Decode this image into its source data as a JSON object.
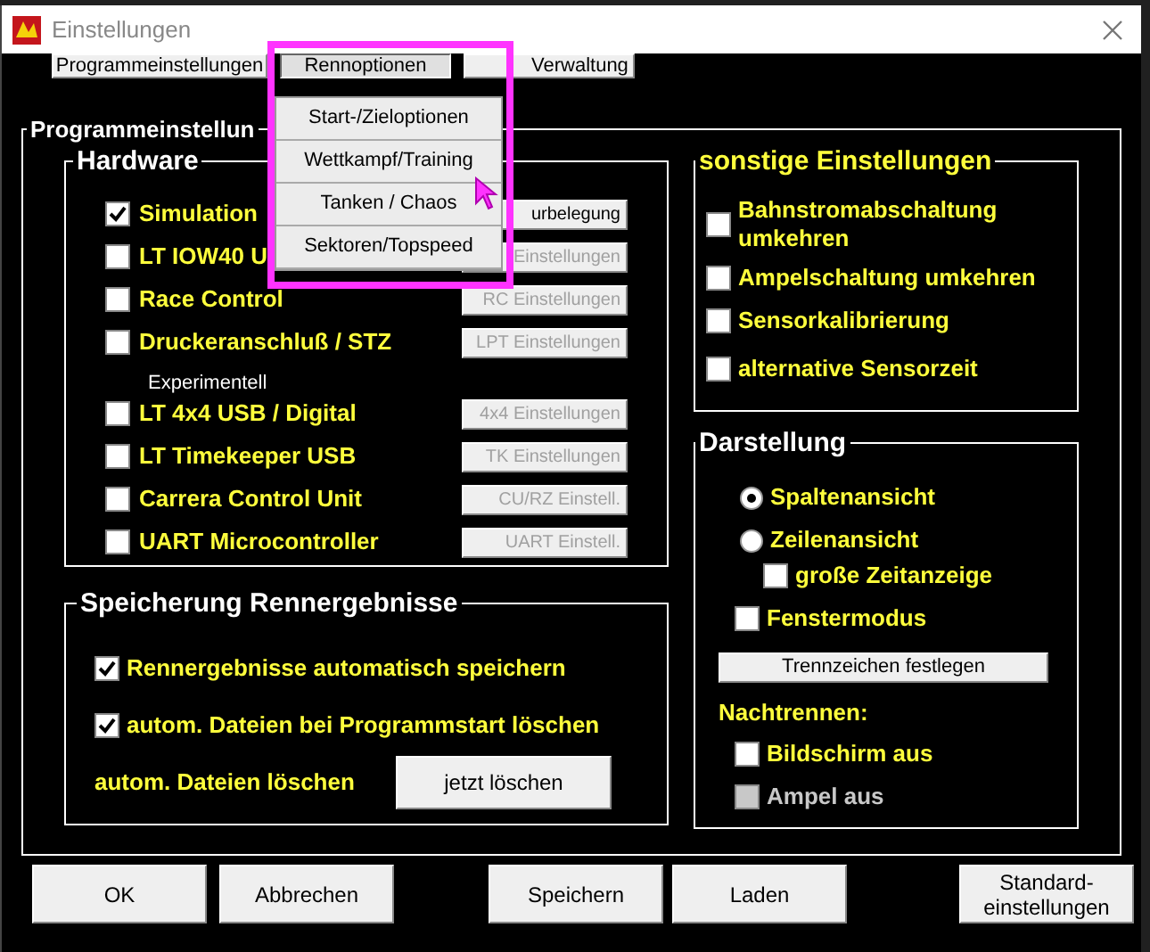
{
  "window": {
    "title": "Einstellungen"
  },
  "tabs": [
    {
      "label": "Programmeinstellungen",
      "selected": false
    },
    {
      "label": "Rennoptionen",
      "selected": true
    },
    {
      "label": "Verwaltung",
      "selected": false
    }
  ],
  "menu": {
    "items": [
      {
        "label": "Start-/Zieloptionen"
      },
      {
        "label": "Wettkampf/Training"
      },
      {
        "label": "Tanken / Chaos"
      },
      {
        "label": "Sektoren/Topspeed"
      }
    ]
  },
  "group": {
    "title": "Programmeinstellun"
  },
  "hardware": {
    "title": "Hardware",
    "items": [
      {
        "label": "Simulation",
        "checked": true,
        "button": "urbelegung",
        "button_disabled": false
      },
      {
        "label": "LT IOW40 U",
        "checked": false,
        "button": "Einstellungen",
        "button_disabled": true
      },
      {
        "label": "Race Control",
        "checked": false,
        "button": "RC Einstellungen",
        "button_disabled": true
      },
      {
        "label": "Druckeranschluß / STZ",
        "checked": false,
        "button": "LPT Einstellungen",
        "button_disabled": true,
        "note": "Experimentell"
      },
      {
        "label": "LT 4x4 USB / Digital",
        "checked": false,
        "button": "4x4 Einstellungen",
        "button_disabled": true
      },
      {
        "label": "LT Timekeeper USB",
        "checked": false,
        "button": "TK Einstellungen",
        "button_disabled": true
      },
      {
        "label": "Carrera Control Unit",
        "checked": false,
        "button": "CU/RZ Einstell.",
        "button_disabled": true
      },
      {
        "label": "UART Microcontroller",
        "checked": false,
        "button": "UART Einstell.",
        "button_disabled": true
      }
    ]
  },
  "results": {
    "title": "Speicherung Rennergebnisse",
    "items": [
      {
        "label": "Rennergebnisse automatisch speichern",
        "checked": true
      },
      {
        "label": "autom. Dateien bei Programmstart löschen",
        "checked": true
      }
    ],
    "delete_label": "autom. Dateien löschen",
    "delete_button": "jetzt löschen"
  },
  "other": {
    "title": "sonstige Einstellungen",
    "items": [
      {
        "label": "Bahnstromabschaltung umkehren",
        "checked": false
      },
      {
        "label": "Ampelschaltung umkehren",
        "checked": false
      },
      {
        "label": "Sensorkalibrierung",
        "checked": false
      },
      {
        "label": "alternative Sensorzeit",
        "checked": false
      }
    ]
  },
  "display": {
    "title": "Darstellung",
    "items": [
      {
        "kind": "radio",
        "label": "Spaltenansicht",
        "selected": true
      },
      {
        "kind": "radio",
        "label": "Zeilenansicht",
        "selected": false
      },
      {
        "kind": "subcheck",
        "label": "große Zeitanzeige",
        "checked": false,
        "disabled": false
      },
      {
        "kind": "checkbox",
        "label": "Fenstermodus",
        "checked": false,
        "disabled": false
      },
      {
        "kind": "button",
        "label": "Trennzeichen festlegen"
      },
      {
        "kind": "heading",
        "label": "Nachtrennen:"
      },
      {
        "kind": "checkbox",
        "label": "Bildschirm aus",
        "checked": false,
        "disabled": false
      },
      {
        "kind": "checkbox",
        "label": "Ampel aus",
        "checked": false,
        "disabled": true
      }
    ]
  },
  "buttons": [
    {
      "label": "OK"
    },
    {
      "label": "Abbrechen"
    },
    {
      "label": "Speichern"
    },
    {
      "label": "Laden"
    },
    {
      "label": "Standard-einstellungen"
    }
  ]
}
